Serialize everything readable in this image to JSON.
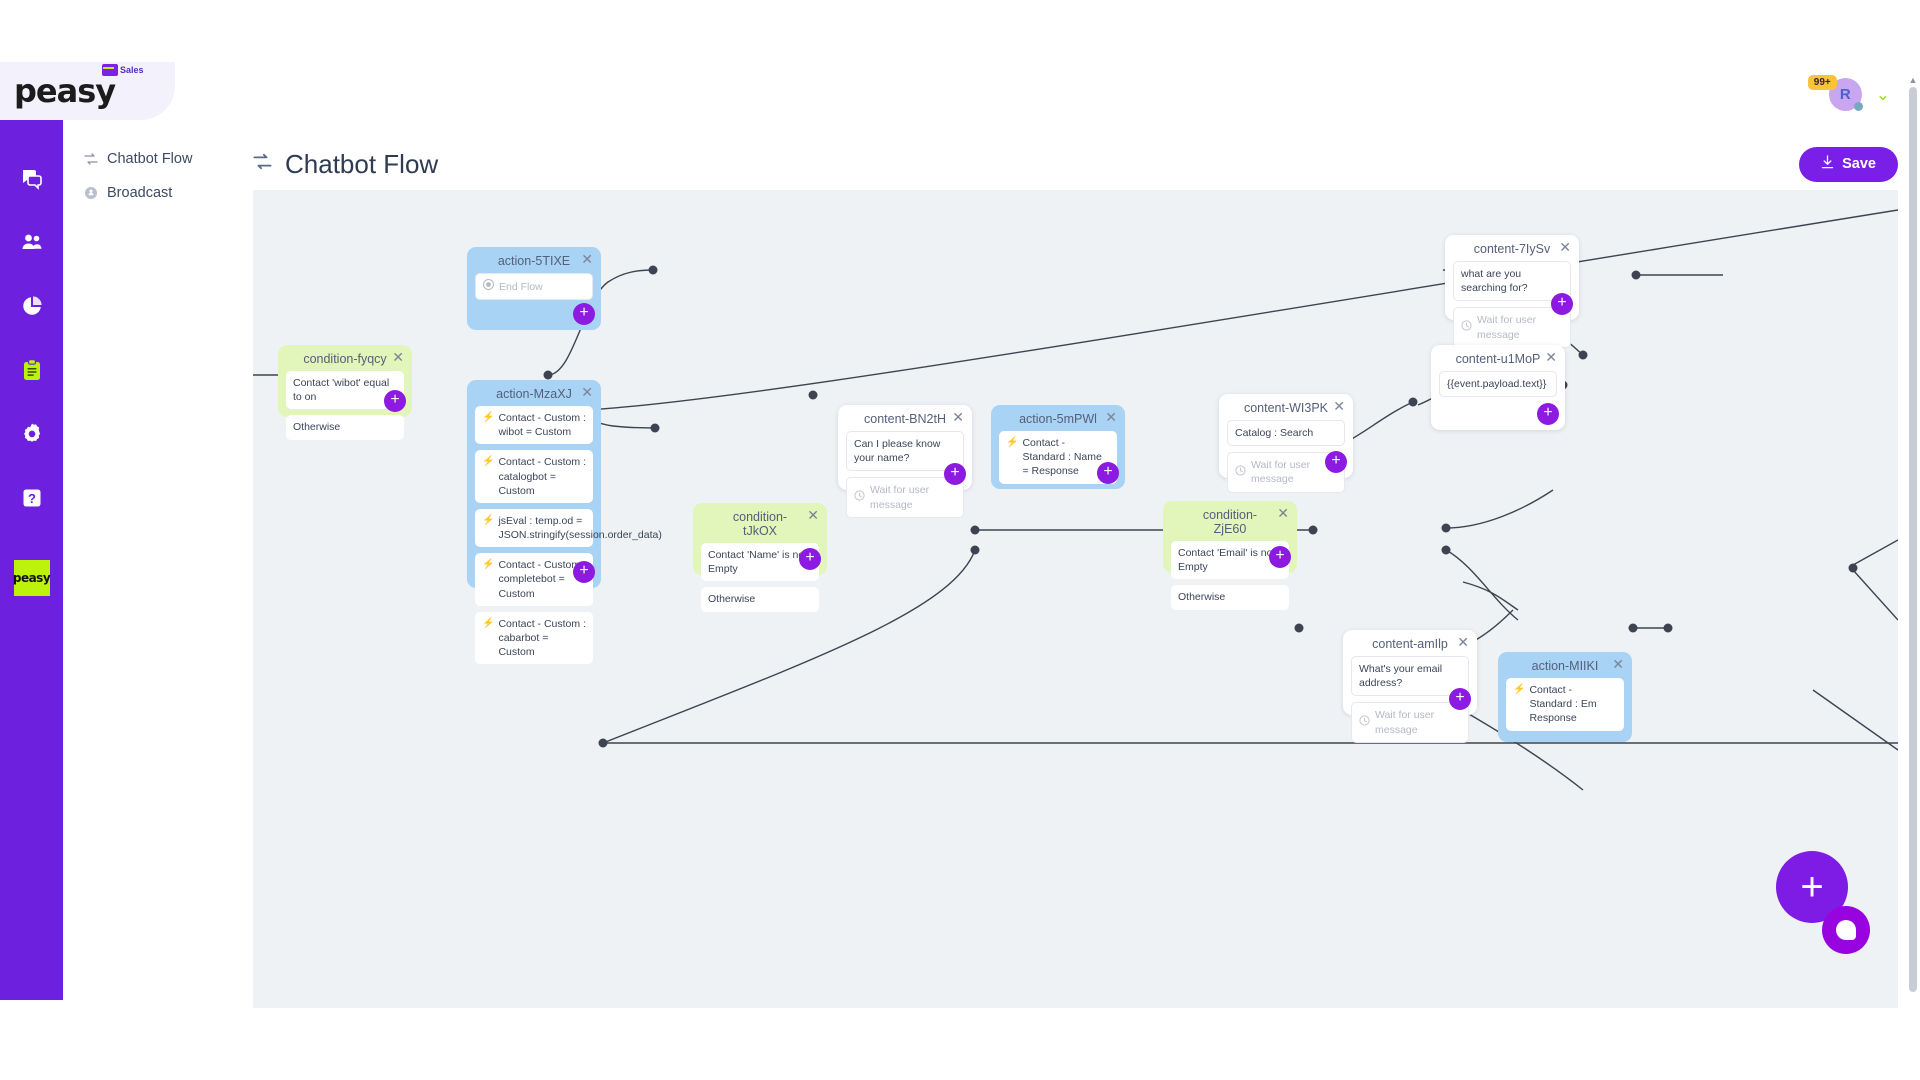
{
  "brand": {
    "name": "peasy",
    "badge_label": "Sales",
    "rail_logo": "peasy",
    "accent": "#6d20dd",
    "accent_lime": "#bdf20b"
  },
  "rail": {
    "items": [
      {
        "icon": "chat-bubbles-icon",
        "name": "chats"
      },
      {
        "icon": "contacts-users-icon",
        "name": "contacts"
      },
      {
        "icon": "pie-chart-icon",
        "name": "analytics"
      },
      {
        "icon": "clipboard-icon",
        "name": "campaigns"
      },
      {
        "icon": "gear-icon",
        "name": "settings"
      },
      {
        "icon": "question-mark-icon",
        "name": "help"
      }
    ]
  },
  "subnav": {
    "items": [
      {
        "label": "Chatbot Flow",
        "icon": "flow-swap-icon"
      },
      {
        "label": "Broadcast",
        "icon": "megaphone-icon"
      }
    ]
  },
  "header": {
    "notifications_badge": "99+",
    "avatar_initial": "R",
    "chevron": "⌄"
  },
  "page": {
    "title": "Chatbot Flow",
    "title_icon": "flow-swap-icon",
    "save_label": "Save",
    "save_icon": "download-icon"
  },
  "labels": {
    "wait_for_user_message": "Wait for user message",
    "otherwise": "Otherwise",
    "plus": "+",
    "close": "✕"
  },
  "nodes": [
    {
      "id": "action-5TIXE",
      "type": "action",
      "title": "action-5TIXE",
      "slots": [
        {
          "kind": "ghost-end",
          "text": "End Flow"
        }
      ]
    },
    {
      "id": "condition-fyqcy",
      "type": "condition",
      "title": "condition-fyqcy",
      "slots": [
        {
          "kind": "plain",
          "text": "Contact 'wibot' equal to on"
        },
        {
          "kind": "plain",
          "text": "Otherwise"
        }
      ]
    },
    {
      "id": "action-MzaXJ",
      "type": "action",
      "title": "action-MzaXJ",
      "slots": [
        {
          "kind": "bolt",
          "text": "Contact - Custom : wibot = Custom"
        },
        {
          "kind": "bolt",
          "text": "Contact - Custom : catalogbot = Custom"
        },
        {
          "kind": "bolt",
          "text": "jsEval : temp.od = JSON.stringify(session.order_data)"
        },
        {
          "kind": "bolt",
          "text": "Contact - Custom : completebot = Custom"
        },
        {
          "kind": "bolt",
          "text": "Contact - Custom : cabarbot = Custom"
        }
      ]
    },
    {
      "id": "content-BN2tH",
      "type": "content",
      "title": "content-BN2tH",
      "slots": [
        {
          "kind": "plain",
          "text": "Can I please know your name?"
        },
        {
          "kind": "wait",
          "text": "Wait for user message"
        }
      ]
    },
    {
      "id": "action-5mPWl",
      "type": "action",
      "title": "action-5mPWl",
      "slots": [
        {
          "kind": "bolt",
          "text": "Contact - Standard : Name = Response"
        }
      ]
    },
    {
      "id": "condition-tJkOX",
      "type": "condition",
      "title": "condition-tJkOX",
      "slots": [
        {
          "kind": "plain",
          "text": "Contact 'Name' is not Empty"
        },
        {
          "kind": "plain",
          "text": "Otherwise"
        }
      ]
    },
    {
      "id": "condition-ZjE60",
      "type": "condition",
      "title": "condition-ZjE60",
      "slots": [
        {
          "kind": "plain",
          "text": "Contact 'Email' is not Empty"
        },
        {
          "kind": "plain",
          "text": "Otherwise"
        }
      ]
    },
    {
      "id": "content-WI3PK",
      "type": "content",
      "title": "content-WI3PK",
      "slots": [
        {
          "kind": "plain",
          "text": "Catalog : Search"
        },
        {
          "kind": "wait",
          "text": "Wait for user message"
        }
      ]
    },
    {
      "id": "content-7IySv",
      "type": "content",
      "title": "content-7IySv",
      "slots": [
        {
          "kind": "plain",
          "text": "what are you searching for?"
        },
        {
          "kind": "wait",
          "text": "Wait for user message"
        }
      ]
    },
    {
      "id": "content-u1MoP",
      "type": "content",
      "title": "content-u1MoP",
      "slots": [
        {
          "kind": "plain",
          "text": "{{event.payload.text}}"
        }
      ]
    },
    {
      "id": "content-amIlp",
      "type": "content",
      "title": "content-amIlp",
      "slots": [
        {
          "kind": "plain",
          "text": "What's your email address?"
        },
        {
          "kind": "wait",
          "text": "Wait for user message"
        }
      ]
    },
    {
      "id": "action-MIIKI",
      "type": "action",
      "title": "action-MIIKI",
      "slots": [
        {
          "kind": "bolt",
          "text": "Contact - Standard : Em Response"
        }
      ]
    }
  ],
  "fab": {
    "add_label": "+",
    "chat_icon": "chat-bubble-icon"
  }
}
